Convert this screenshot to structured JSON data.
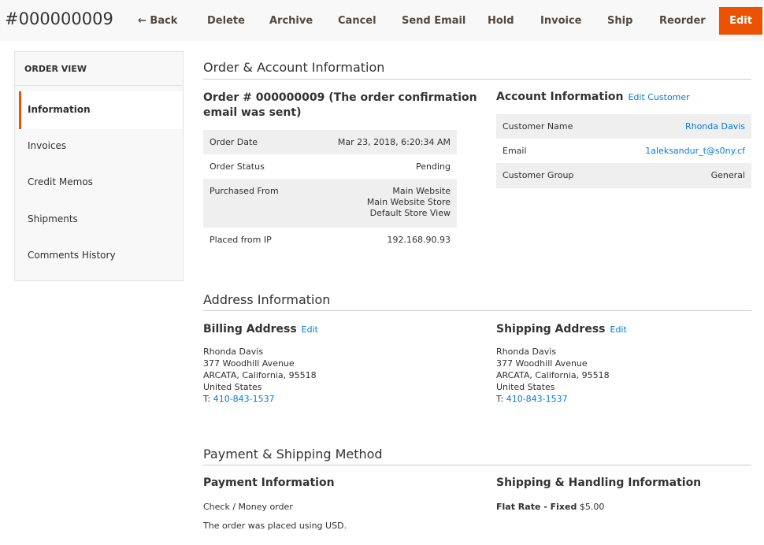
{
  "header": {
    "order_number": "#000000009",
    "buttons": {
      "back": "← Back",
      "delete": "Delete",
      "archive": "Archive",
      "cancel": "Cancel",
      "send_email": "Send Email",
      "hold": "Hold",
      "invoice": "Invoice",
      "ship": "Ship",
      "reorder": "Reorder",
      "edit": "Edit"
    }
  },
  "sidebar": {
    "title": "ORDER VIEW",
    "items": [
      {
        "label": "Information",
        "active": true
      },
      {
        "label": "Invoices",
        "active": false
      },
      {
        "label": "Credit Memos",
        "active": false
      },
      {
        "label": "Shipments",
        "active": false
      },
      {
        "label": "Comments History",
        "active": false
      }
    ]
  },
  "order_account": {
    "section_title": "Order & Account Information",
    "order_heading_line1": "Order # 000000009 (The order confirmation",
    "order_heading_line2": "email was sent)",
    "order_rows": [
      {
        "label": "Order Date",
        "value": "Mar 23, 2018, 6:20:34 AM"
      },
      {
        "label": "Order Status",
        "value": "Pending"
      },
      {
        "label": "Purchased From",
        "value_lines": [
          "Main Website",
          "Main Website Store",
          "Default Store View"
        ]
      },
      {
        "label": "Placed from IP",
        "value": "192.168.90.93"
      }
    ],
    "account_heading": "Account Information",
    "edit_customer_link": "Edit Customer",
    "account_rows": [
      {
        "label": "Customer Name",
        "value": "Rhonda Davis"
      },
      {
        "label": "Email",
        "value": "1aleksandur_t@s0ny.cf"
      },
      {
        "label": "Customer Group",
        "value": "General"
      }
    ]
  },
  "address": {
    "section_title": "Address Information",
    "billing": {
      "heading": "Billing Address",
      "edit_link": "Edit",
      "lines": [
        "Rhonda Davis",
        "377 Woodhill Avenue",
        "ARCATA, California, 95518",
        "United States"
      ],
      "phone_prefix": "T: ",
      "phone": "410-843-1537"
    },
    "shipping": {
      "heading": "Shipping Address",
      "edit_link": "Edit",
      "lines": [
        "Rhonda Davis",
        "377 Woodhill Avenue",
        "ARCATA, California, 95518",
        "United States"
      ],
      "phone_prefix": "T: ",
      "phone": "410-843-1537"
    }
  },
  "payment_shipping": {
    "section_title": "Payment & Shipping Method",
    "payment_heading": "Payment Information",
    "payment_method": "Check / Money order",
    "currency_note": "The order was placed using USD.",
    "shipping_heading": "Shipping & Handling Information",
    "shipping_method": "Flat Rate - Fixed",
    "shipping_price": "$5.00"
  },
  "colors": {
    "accent": "#eb5202",
    "link": "#007bdb",
    "row_shade": "#efefef"
  }
}
